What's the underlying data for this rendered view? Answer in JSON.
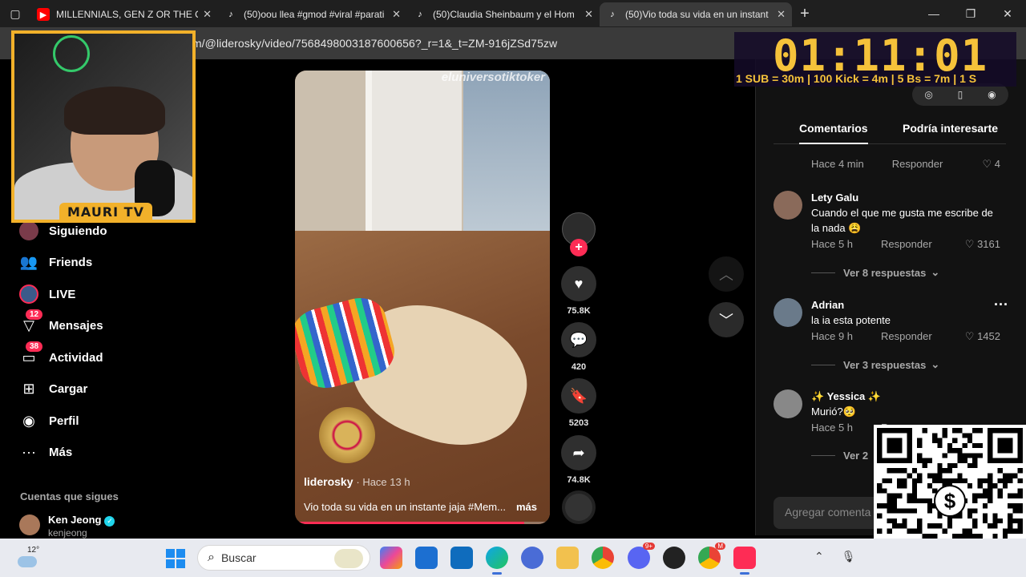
{
  "browser": {
    "tabs": [
      {
        "title": "MILLENNIALS, GEN Z OR THE CA",
        "icon": "youtube-icon",
        "active": false
      },
      {
        "title": "(50)oou llea #gmod #viral #parati",
        "icon": "tiktok-icon",
        "active": false
      },
      {
        "title": "(50)Claudia Sheinbaum y el Hom",
        "icon": "tiktok-icon",
        "active": false
      },
      {
        "title": "(50)Vio toda su vida en un instant",
        "icon": "tiktok-icon",
        "active": true
      }
    ],
    "url": "om/@liderosky/video/7568498003187600656?_r=1&_t=ZM-916jZSd75zw"
  },
  "stream": {
    "cam_name": "MAURI TV",
    "timer": "01:11:01",
    "rules": "1 SUB = 30m | 100 Kick = 4m | 5 Bs = 7m | 1 S"
  },
  "sidebar": {
    "items": [
      {
        "label": "Siguiendo",
        "icon": "following-avatar-icon"
      },
      {
        "label": "Friends",
        "icon": "friends-icon"
      },
      {
        "label": "LIVE",
        "icon": "live-icon"
      },
      {
        "label": "Mensajes",
        "icon": "messages-icon",
        "badge": "12"
      },
      {
        "label": "Actividad",
        "icon": "activity-icon",
        "badge": "38"
      },
      {
        "label": "Cargar",
        "icon": "upload-icon"
      },
      {
        "label": "Perfil",
        "icon": "profile-icon"
      },
      {
        "label": "Más",
        "icon": "more-icon"
      }
    ],
    "following_header": "Cuentas que sigues",
    "following": [
      {
        "name": "Ken Jeong",
        "handle": "kenjeong"
      }
    ]
  },
  "video": {
    "watermark": "eluniversotiktoker",
    "author": "liderosky",
    "time": "· Hace 13 h",
    "caption": "Vio toda su vida en un instante jaja #Mem...",
    "more": "más",
    "progress": 0.9,
    "likes": "75.8K",
    "comments": "420",
    "saves": "5203",
    "shares": "74.8K"
  },
  "panel": {
    "tabs": [
      "Comentarios",
      "Podría interesarte"
    ],
    "first_meta": {
      "time": "Hace 4 min",
      "reply": "Responder",
      "likes": "4"
    },
    "comments": [
      {
        "name": "Lety Galu",
        "text": "Cuando el que me gusta me escribe de la nada 😩",
        "time": "Hace 5 h",
        "reply": "Responder",
        "likes": "3161",
        "more": "Ver 8 respuestas"
      },
      {
        "name": "Adrian",
        "text": "la ia esta potente",
        "time": "Hace 9 h",
        "reply": "Responder",
        "likes": "1452",
        "more": "Ver 3 respuestas"
      },
      {
        "name": "✨ Yessica ✨",
        "text": "Murió?🥺",
        "time": "Hace 5 h",
        "reply": "R",
        "more": "Ver 2"
      }
    ],
    "add_placeholder": "Agregar comenta"
  },
  "taskbar": {
    "temp": "12°",
    "search": "Buscar",
    "apps": [
      "copilot-icon",
      "store-icon",
      "outlook-icon",
      "edge-icon",
      "browser-icon",
      "file-explorer-icon",
      "chrome-icon",
      "discord-icon",
      "obs-icon",
      "chrome-profile-icon",
      "tiktok-icon"
    ],
    "discord_badge": "9+",
    "chrome_badge": "M"
  },
  "colors": {
    "accent": "#fe2c55",
    "timer": "#f5c23a",
    "cam_border": "#f2b12a"
  }
}
